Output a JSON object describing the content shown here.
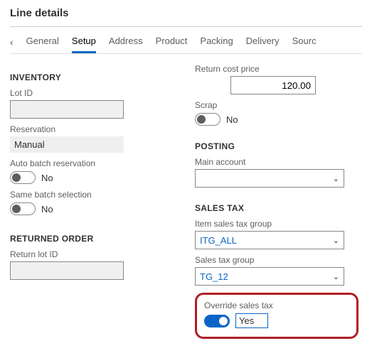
{
  "header": {
    "title": "Line details"
  },
  "tabs": {
    "items": [
      {
        "label": "General"
      },
      {
        "label": "Setup"
      },
      {
        "label": "Address"
      },
      {
        "label": "Product"
      },
      {
        "label": "Packing"
      },
      {
        "label": "Delivery"
      },
      {
        "label": "Sourc"
      }
    ],
    "active_index": 1,
    "prev_icon": "chevron-left"
  },
  "left": {
    "inventory": {
      "title": "INVENTORY",
      "lot_id": {
        "label": "Lot ID",
        "value": ""
      },
      "reservation": {
        "label": "Reservation",
        "value": "Manual"
      },
      "auto_batch": {
        "label": "Auto batch reservation",
        "on": false,
        "text": "No"
      },
      "same_batch": {
        "label": "Same batch selection",
        "on": false,
        "text": "No"
      }
    },
    "returned_order": {
      "title": "RETURNED ORDER",
      "return_lot_id": {
        "label": "Return lot ID",
        "value": ""
      }
    }
  },
  "right": {
    "return_cost_price": {
      "label": "Return cost price",
      "value": "120.00"
    },
    "scrap": {
      "label": "Scrap",
      "on": false,
      "text": "No"
    },
    "posting": {
      "title": "POSTING",
      "main_account": {
        "label": "Main account",
        "value": ""
      }
    },
    "sales_tax": {
      "title": "SALES TAX",
      "item_group": {
        "label": "Item sales tax group",
        "value": "ITG_ALL"
      },
      "group": {
        "label": "Sales tax group",
        "value": "TG_12"
      },
      "override": {
        "label": "Override sales tax",
        "on": true,
        "text": "Yes"
      }
    }
  }
}
